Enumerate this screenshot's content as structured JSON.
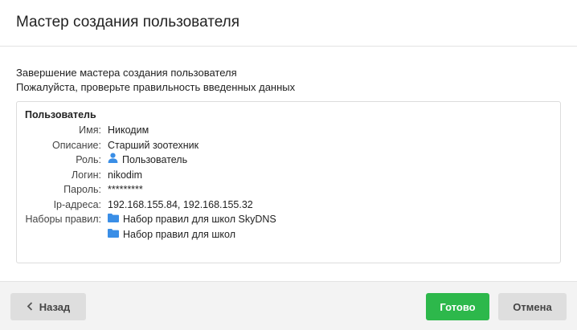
{
  "header": {
    "title": "Мастер создания пользователя"
  },
  "intro": {
    "line1": "Завершение мастера создания пользователя",
    "line2": "Пожалуйста, проверьте правильность введенных данных"
  },
  "user_section": {
    "title": "Пользователь",
    "fields": {
      "name": {
        "label": "Имя:",
        "value": "Никодим"
      },
      "description": {
        "label": "Описание:",
        "value": "Старший зоотехник"
      },
      "role": {
        "label": "Роль:",
        "value": "Пользователь",
        "icon": "user-icon"
      },
      "login": {
        "label": "Логин:",
        "value": "nikodim"
      },
      "password": {
        "label": "Пароль:",
        "value": "*********"
      },
      "ip": {
        "label": "Ip-адреса:",
        "value": "192.168.155.84, 192.168.155.32"
      },
      "rulesets": {
        "label": "Наборы правил:",
        "items": [
          "Набор правил для школ SkyDNS",
          "Набор правил для школ"
        ],
        "icon": "folder-icon"
      }
    }
  },
  "footer": {
    "back_label": "Назад",
    "done_label": "Готово",
    "cancel_label": "Отмена"
  },
  "colors": {
    "accent": "#2db84b",
    "icon_blue": "#3a8ee6",
    "button_gray": "#dedede"
  }
}
